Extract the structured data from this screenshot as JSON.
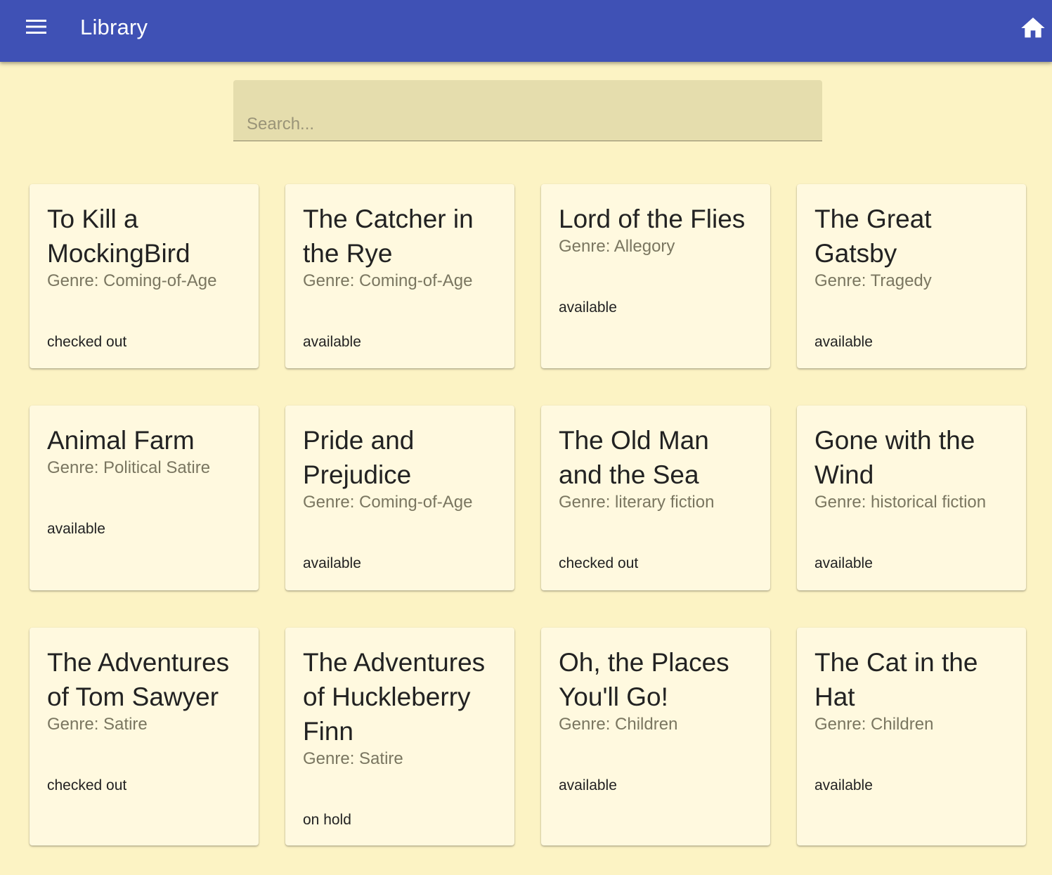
{
  "appbar": {
    "title": "Library",
    "menu_icon": "menu-icon",
    "home_icon": "home-icon",
    "background": "#3f51b5"
  },
  "search": {
    "placeholder": "Search...",
    "value": ""
  },
  "books": [
    {
      "title": "To Kill a MockingBird",
      "genre": "Genre: Coming-of-Age",
      "status": "checked out"
    },
    {
      "title": "The Catcher in the Rye",
      "genre": "Genre: Coming-of-Age",
      "status": "available"
    },
    {
      "title": "Lord of the Flies",
      "genre": "Genre: Allegory",
      "status": "available"
    },
    {
      "title": "The Great Gatsby",
      "genre": "Genre: Tragedy",
      "status": "available"
    },
    {
      "title": "Animal Farm",
      "genre": "Genre: Political Satire",
      "status": "available"
    },
    {
      "title": "Pride and Prejudice",
      "genre": "Genre: Coming-of-Age",
      "status": "available"
    },
    {
      "title": "The Old Man and the Sea",
      "genre": "Genre: literary fiction",
      "status": "checked out"
    },
    {
      "title": "Gone with the Wind",
      "genre": "Genre: historical fiction",
      "status": "available"
    },
    {
      "title": "The Adventures of Tom Sawyer",
      "genre": "Genre: Satire",
      "status": "checked out"
    },
    {
      "title": "The Adventures of Huckleberry Finn",
      "genre": "Genre: Satire",
      "status": "on hold"
    },
    {
      "title": "Oh, the Places You'll Go!",
      "genre": "Genre: Children",
      "status": "available"
    },
    {
      "title": "The Cat in the Hat",
      "genre": "Genre: Children",
      "status": "available"
    }
  ]
}
